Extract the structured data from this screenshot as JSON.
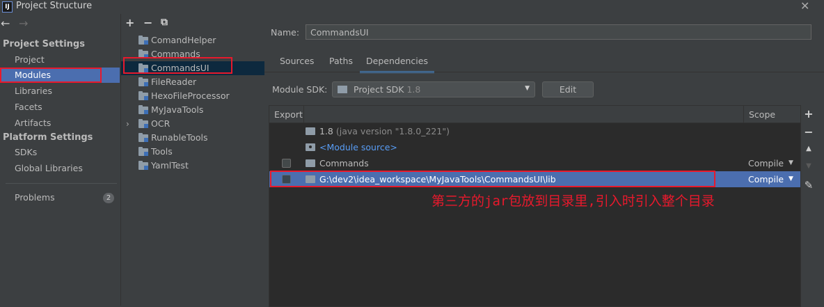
{
  "window": {
    "app_icon": "IJ",
    "title": "Project Structure",
    "close": "✕"
  },
  "nav": {
    "back": "←",
    "forward": "→",
    "project_settings": {
      "heading": "Project Settings",
      "items": [
        "Project",
        "Modules",
        "Libraries",
        "Facets",
        "Artifacts"
      ]
    },
    "platform_settings": {
      "heading": "Platform Settings",
      "items": [
        "SDKs",
        "Global Libraries"
      ]
    },
    "problems": {
      "label": "Problems",
      "count": "2"
    },
    "selected": "Modules"
  },
  "modules_toolbar": {
    "add": "+",
    "remove": "−",
    "copy": "⧉"
  },
  "modules": [
    "ComandHelper",
    "Commands",
    "CommandsUI",
    "FileReader",
    "HexoFileProcessor",
    "MyJavaTools",
    "OCR",
    "RunableTools",
    "Tools",
    "YamlTest"
  ],
  "selected_module": "CommandsUI",
  "expandable_module": "OCR",
  "expand_arrow": "›",
  "detail": {
    "name_label": "Name:",
    "name_value": "CommandsUI",
    "tabs": [
      "Sources",
      "Paths",
      "Dependencies"
    ],
    "active_tab": "Dependencies",
    "sdk_label": "Module SDK:",
    "sdk_value": "Project SDK",
    "sdk_version": "1.8",
    "sdk_chevron": "▼",
    "edit_label": "Edit"
  },
  "dependencies": {
    "header": {
      "export": "Export",
      "scope": "Scope"
    },
    "rows": [
      {
        "name": "1.8",
        "sub": "(java version \"1.8.0_221\")",
        "checkbox": false,
        "scope": ""
      },
      {
        "name": "<Module source>",
        "sub": "",
        "checkbox": false,
        "scope": ""
      },
      {
        "name": "Commands",
        "sub": "",
        "checkbox": true,
        "scope": "Compile",
        "scope_arrow": "▼"
      },
      {
        "name": "G:\\dev2\\idea_workspace\\MyJavaTools\\CommandsUI\\lib",
        "sub": "",
        "checkbox": true,
        "scope": "Compile",
        "scope_arrow": "▼",
        "selected": true
      }
    ]
  },
  "side_toolbar": {
    "add": "+",
    "remove": "−",
    "up": "▲",
    "down": "▼",
    "edit": "✎"
  },
  "annotation": {
    "text": "第三方的jar包放到目录里,引入时引入整个目录",
    "color": "#e8192c"
  },
  "colors": {
    "selection": "#4b6eaf",
    "accent_tab": "#4a88c7",
    "link": "#589df6",
    "background": "#3c3f41"
  }
}
